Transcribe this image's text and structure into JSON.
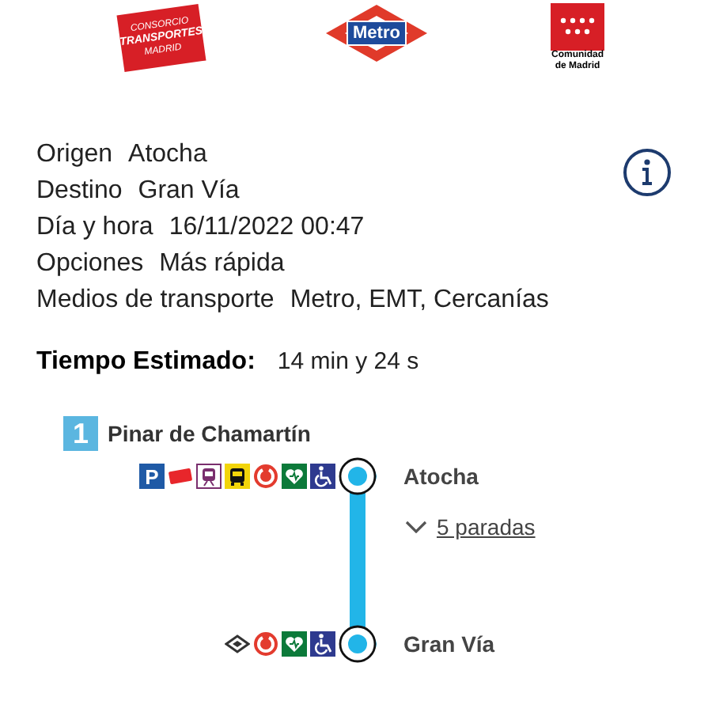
{
  "logos": [
    {
      "kind": "consorcio",
      "lines": [
        "CONSORCIO",
        "TRANSPORTES",
        "MADRID"
      ]
    },
    {
      "kind": "metro",
      "lines": [
        "Metro"
      ]
    },
    {
      "kind": "comunidad",
      "lines": [
        "Comunidad",
        "de Madrid"
      ]
    }
  ],
  "details": [
    {
      "label": "Origen",
      "value": "Atocha"
    },
    {
      "label": "Destino",
      "value": "Gran Vía"
    },
    {
      "label": "Día y hora",
      "value": "16/11/2022 00:47"
    },
    {
      "label": "Opciones",
      "value": "Más rápida"
    },
    {
      "label": "Medios de transporte",
      "value": "Metro, EMT, Cercanías"
    }
  ],
  "estimate": {
    "label": "Tiempo Estimado:",
    "value": "14 min y 24 s"
  },
  "route": {
    "line": {
      "number": "1",
      "color": "#5bb6e0",
      "direction": "Pinar de Chamartín"
    },
    "stops_link": "5 paradas",
    "stations": [
      {
        "name": "Atocha",
        "services": [
          {
            "kind": "parking",
            "label": "P"
          },
          {
            "kind": "card"
          },
          {
            "kind": "train"
          },
          {
            "kind": "bus"
          },
          {
            "kind": "circular"
          },
          {
            "kind": "defibrillator"
          },
          {
            "kind": "accessible"
          }
        ]
      },
      {
        "name": "Gran Vía",
        "services": [
          {
            "kind": "diamond"
          },
          {
            "kind": "circular"
          },
          {
            "kind": "defibrillator"
          },
          {
            "kind": "accessible"
          }
        ]
      }
    ]
  }
}
